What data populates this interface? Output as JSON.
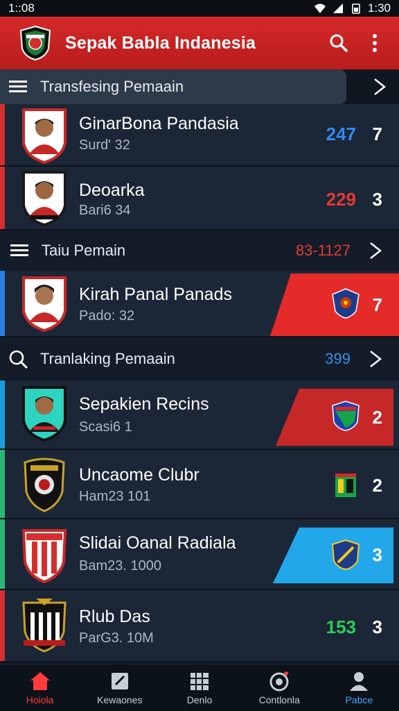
{
  "status_bar": {
    "time": "1::08",
    "clock": "1:30"
  },
  "app_bar": {
    "title": "Sepak Babla Indanesia",
    "search_icon": "search-icon",
    "menu_icon": "more-vert-icon"
  },
  "sections": [
    {
      "label": "Transfesing Pemaain",
      "count": "",
      "icon": "list-icon"
    },
    {
      "label": "Taiu Pemain",
      "count": "83-1127",
      "icon": "list-icon",
      "count_color": "#e53935"
    },
    {
      "label": "Tranlaking Pemaain",
      "count": "399",
      "icon": "search-icon",
      "count_color": "#3a8ee6"
    }
  ],
  "rows": [
    {
      "name": "GinarBona Pandasia",
      "sub": "Surd' 32",
      "score": "247",
      "rank": "7",
      "score_color": "#2f8bf0",
      "edge_color": "#d32f2f"
    },
    {
      "name": "Deoarka",
      "sub": "Bari6 34",
      "score": "229",
      "rank": "3",
      "score_color": "#e53935",
      "edge_color": "#d32f2f"
    },
    {
      "name": "Kirah Panal Panads",
      "sub": "Pado: 32",
      "score": "",
      "rank": "7",
      "badge_color": "#e52a2a",
      "edge_color": "#2a7fe0"
    },
    {
      "name": "Sepakien Recins",
      "sub": "Scasi6  1",
      "score": "",
      "rank": "2",
      "badge_color": "#c62828",
      "edge_color": "#1e9be0"
    },
    {
      "name": "Uncaome Clubr",
      "sub": "Ham23 101",
      "score": "",
      "rank": "2",
      "edge_color": "#2bb673"
    },
    {
      "name": "Slidai Oanal Radiala",
      "sub": "Bam23. 1000",
      "score": "",
      "rank": "3",
      "badge_color": "#21a7ea",
      "edge_color": "#2bb673"
    },
    {
      "name": "Rlub Das",
      "sub": "ParG3. 10M",
      "score": "153",
      "rank": "3",
      "score_color": "#2ecc55",
      "edge_color": "#d32f2f"
    }
  ],
  "bottom_nav": [
    {
      "label": "Hoiola",
      "icon": "home-icon"
    },
    {
      "label": "Kewaones",
      "icon": "news-icon"
    },
    {
      "label": "Denlo",
      "icon": "grid-icon"
    },
    {
      "label": "Contlonla",
      "icon": "target-icon"
    },
    {
      "label": "Pabce",
      "icon": "user-icon"
    }
  ],
  "colors": {
    "app_bar": "#d42a2a",
    "background": "#0f1a26",
    "row": "#1b2636",
    "active_nav": "#ff3b3b"
  }
}
